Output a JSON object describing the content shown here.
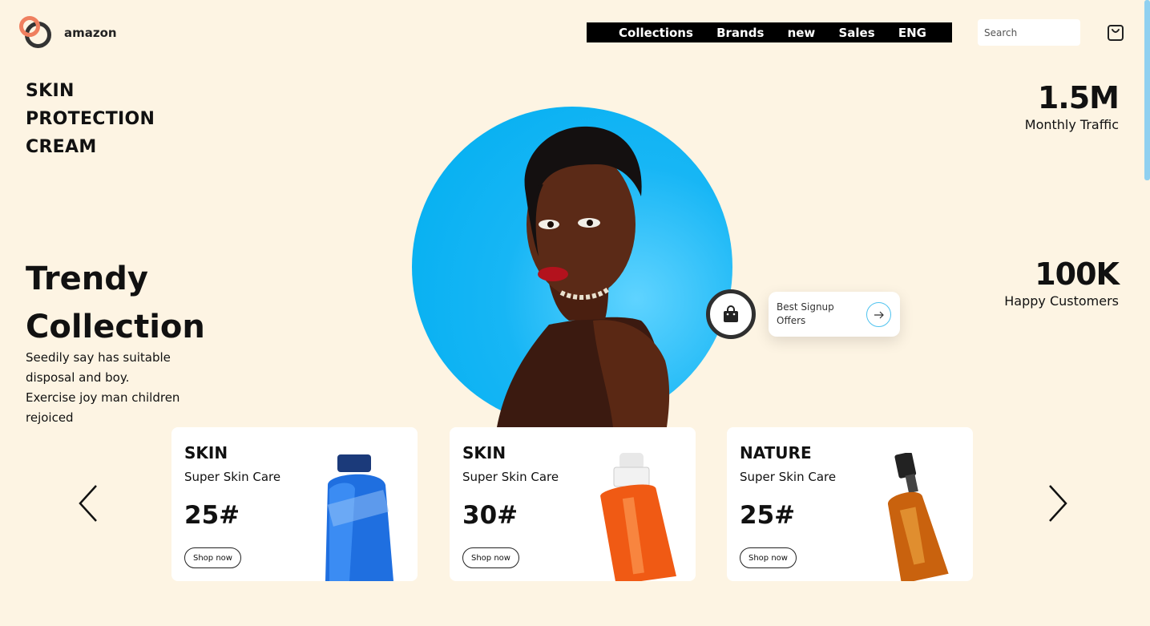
{
  "brand": {
    "name": "amazon"
  },
  "nav": {
    "items": [
      "Collections",
      "Brands",
      "new",
      "Sales",
      "ENG"
    ]
  },
  "search": {
    "placeholder": "Search"
  },
  "hero": {
    "title_lines": [
      "SKIN",
      "PROTECTION",
      "CREAM"
    ],
    "trendy_lines": [
      "Trendy",
      "Collection"
    ],
    "description_lines": [
      "Seedily say has suitable",
      "disposal and boy.",
      "Exercise joy man children",
      "rejoiced"
    ]
  },
  "stats": [
    {
      "value": "1.5M",
      "label": "Monthly Traffic"
    },
    {
      "value": "100K",
      "label": "Happy Customers"
    }
  ],
  "offer": {
    "text_line1": "Best Signup",
    "text_line2": "Offers"
  },
  "cards": [
    {
      "category": "SKIN",
      "subtitle": "Super Skin Care",
      "price": "25#",
      "button": "Shop now",
      "product_color": "#1f6fe0"
    },
    {
      "category": "SKIN",
      "subtitle": "Super Skin Care",
      "price": "30#",
      "button": "Shop now",
      "product_color": "#f05a14"
    },
    {
      "category": "NATURE",
      "subtitle": "Super Skin Care",
      "price": "25#",
      "button": "Shop now",
      "product_color": "#c9620e"
    }
  ],
  "icons": {
    "cart": "shopping-bag-icon",
    "bag": "bag-icon",
    "offer_arrow": "arrow-right-icon",
    "prev": "chevron-left-icon",
    "next": "chevron-right-icon"
  },
  "colors": {
    "background": "#fdf4e3",
    "accent_blue": "#00aef0",
    "logo_orange": "#ef7f5f",
    "nav_bg": "#000000"
  }
}
